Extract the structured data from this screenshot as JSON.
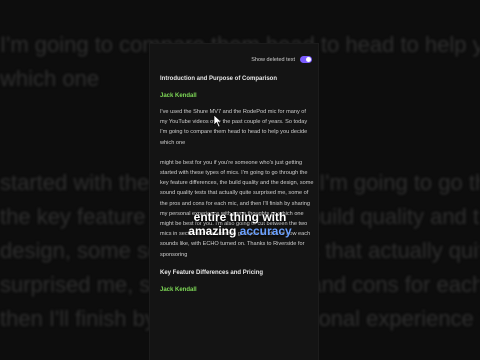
{
  "background_text": [
    "I'm going to compare them head to head to help you decide",
    "which one",
    "",
    "",
    "",
    "",
    "started with these types of mics. I'm going to go through",
    "the key feature differences, the build quality and the",
    "design, some sound quality tests that actually quite",
    "surprised me, some of the pros and cons for each mic, an",
    "then I'll finish by sharing my personal experience with some"
  ],
  "toggle": {
    "label": "Show deleted text",
    "on": true
  },
  "transcript": {
    "section1_title": "Introduction and Purpose of Comparison",
    "speaker1": "Jack Kendall",
    "para1": "I've used the Shure MV7 and the RodePod mic for many of my YouTube videos over the past couple of years. So today I'm going to compare them head to head to help you decide which one",
    "para2": "might be best for you if you're someone who's just getting started with these types of mics. I'm going to go through the key feature differences, the build quality and the design, some sound quality tests that actually quite surprised me, some of the pros and cons for each mic, and then I'll finish by sharing my personal experience with some thoughts on which one might be best for you. I'm also going to cut between the two mics in sections of the video to give you an idea of how each sounds like, with ECHO turned on. Thanks to Riverside for sponsoring",
    "section2_title": "Key Feature Differences and Pricing",
    "speaker2": "Jack Kendall"
  },
  "caption": {
    "line1": "entire thing with",
    "line2_prefix": "amazing ",
    "line2_highlight": "accuracy"
  },
  "colors": {
    "toggle_on": "#7b5cff",
    "speaker": "#7ed957",
    "highlight": "#6aa0ff"
  }
}
